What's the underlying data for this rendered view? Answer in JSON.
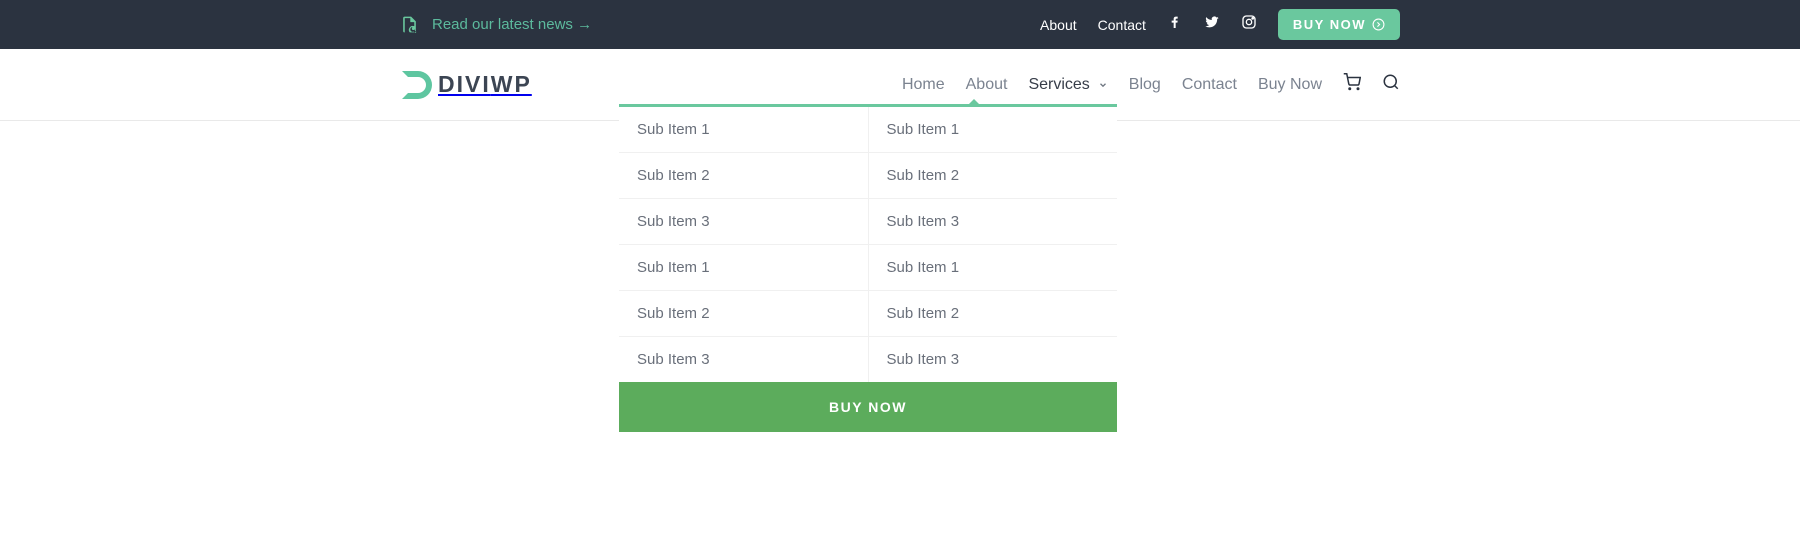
{
  "topbar": {
    "news_label": "Read our latest news →",
    "links": [
      "About",
      "Contact"
    ],
    "buy_now": "BUY NOW"
  },
  "logo": {
    "part1": "DIVI",
    "part2": "WP"
  },
  "nav": {
    "items": [
      "Home",
      "About",
      "Services",
      "Blog",
      "Contact",
      "Buy Now"
    ]
  },
  "mega": {
    "col1": [
      "Sub Item 1",
      "Sub Item 2",
      "Sub Item 3",
      "Sub Item 1",
      "Sub Item 2",
      "Sub Item 3"
    ],
    "col2": [
      "Sub Item 1",
      "Sub Item 2",
      "Sub Item 3",
      "Sub Item 1",
      "Sub Item 2",
      "Sub Item 3"
    ],
    "cta": "BUY NOW"
  }
}
